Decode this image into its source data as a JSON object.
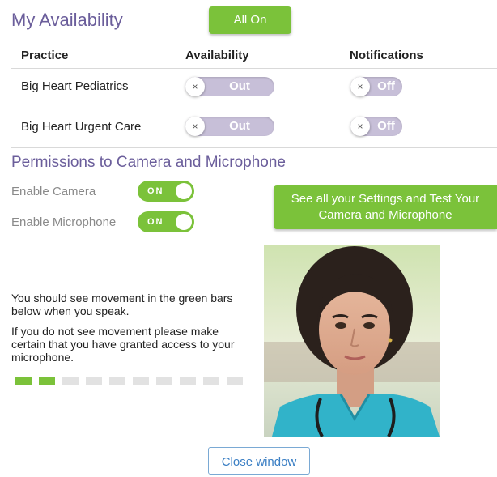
{
  "header": {
    "title": "My Availability",
    "all_on_label": "All On"
  },
  "table": {
    "headers": {
      "practice": "Practice",
      "availability": "Availability",
      "notifications": "Notifications"
    },
    "rows": [
      {
        "practice": "Big Heart Pediatrics",
        "availability": "Out",
        "notifications": "Off"
      },
      {
        "practice": "Big Heart Urgent Care",
        "availability": "Out",
        "notifications": "Off"
      }
    ],
    "toggle_x": "×"
  },
  "permissions": {
    "title": "Permissions to Camera and Microphone",
    "camera_label": "Enable Camera",
    "camera_state": "ON",
    "mic_label": "Enable Microphone",
    "mic_state": "ON",
    "settings_button": "See all your Settings and Test Your Camera and Microphone"
  },
  "mic_test": {
    "line1": "You should see movement in the green bars below when you speak.",
    "line2": "If you do not see movement please make certain that you have granted access to your microphone.",
    "bars_total": 10,
    "bars_active": 2
  },
  "footer": {
    "close_label": "Close window"
  },
  "colors": {
    "accent_purple": "#6b5e9b",
    "green": "#7bc23a",
    "toggle_off": "#c7bfd8",
    "bar_inactive": "#e2e2e2",
    "link_blue": "#3b7fc4"
  }
}
